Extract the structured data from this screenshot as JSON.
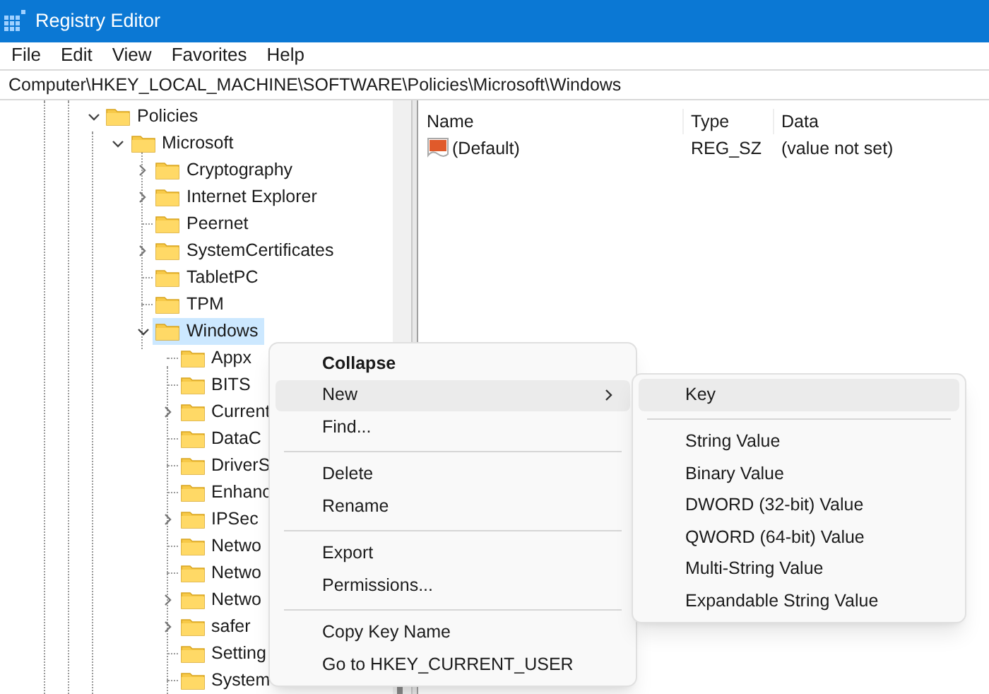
{
  "window": {
    "title": "Registry Editor"
  },
  "menu_bar": [
    "File",
    "Edit",
    "View",
    "Favorites",
    "Help"
  ],
  "address": "Computer\\HKEY_LOCAL_MACHINE\\SOFTWARE\\Policies\\Microsoft\\Windows",
  "tree": [
    {
      "label": "Policies",
      "kind": "branch",
      "expanded": true,
      "selected": false,
      "children": [
        {
          "label": "Microsoft",
          "kind": "branch",
          "expanded": true,
          "selected": false,
          "children": [
            {
              "label": "Cryptography",
              "kind": "branch",
              "expanded": false,
              "selected": false
            },
            {
              "label": "Internet Explorer",
              "kind": "branch",
              "expanded": false,
              "selected": false
            },
            {
              "label": "Peernet",
              "kind": "leaf",
              "selected": false
            },
            {
              "label": "SystemCertificates",
              "kind": "branch",
              "expanded": false,
              "selected": false
            },
            {
              "label": "TabletPC",
              "kind": "leaf",
              "selected": false
            },
            {
              "label": "TPM",
              "kind": "leaf",
              "selected": false
            },
            {
              "label": "Windows",
              "kind": "branch",
              "expanded": true,
              "selected": true,
              "children": [
                {
                  "label": "Appx",
                  "kind": "leaf",
                  "selected": false
                },
                {
                  "label": "BITS",
                  "kind": "leaf",
                  "selected": false
                },
                {
                  "label": "Current",
                  "kind": "branch",
                  "expanded": false,
                  "selected": false
                },
                {
                  "label": "DataC",
                  "kind": "leaf",
                  "selected": false
                },
                {
                  "label": "DriverS",
                  "kind": "leaf",
                  "selected": false
                },
                {
                  "label": "Enhanc",
                  "kind": "leaf",
                  "selected": false
                },
                {
                  "label": "IPSec",
                  "kind": "branch",
                  "expanded": false,
                  "selected": false
                },
                {
                  "label": "Netwo",
                  "kind": "leaf",
                  "selected": false
                },
                {
                  "label": "Netwo",
                  "kind": "leaf",
                  "selected": false
                },
                {
                  "label": "Netwo",
                  "kind": "branch",
                  "expanded": false,
                  "selected": false
                },
                {
                  "label": "safer",
                  "kind": "branch",
                  "expanded": false,
                  "selected": false
                },
                {
                  "label": "Setting",
                  "kind": "leaf",
                  "selected": false
                },
                {
                  "label": "System",
                  "kind": "leaf",
                  "selected": false
                }
              ]
            }
          ]
        }
      ]
    }
  ],
  "values_table": {
    "columns": [
      "Name",
      "Type",
      "Data"
    ],
    "rows": [
      {
        "name": "(Default)",
        "type": "REG_SZ",
        "data": "(value not set)"
      }
    ]
  },
  "context_menu": [
    {
      "kind": "item",
      "label": "Collapse",
      "default": true,
      "selected": false,
      "submenu": false
    },
    {
      "kind": "item",
      "label": "New",
      "default": false,
      "selected": true,
      "submenu": true
    },
    {
      "kind": "item",
      "label": "Find...",
      "default": false,
      "selected": false,
      "submenu": false
    },
    {
      "kind": "separator"
    },
    {
      "kind": "item",
      "label": "Delete",
      "default": false,
      "selected": false,
      "submenu": false
    },
    {
      "kind": "item",
      "label": "Rename",
      "default": false,
      "selected": false,
      "submenu": false
    },
    {
      "kind": "separator"
    },
    {
      "kind": "item",
      "label": "Export",
      "default": false,
      "selected": false,
      "submenu": false
    },
    {
      "kind": "item",
      "label": "Permissions...",
      "default": false,
      "selected": false,
      "submenu": false
    },
    {
      "kind": "separator"
    },
    {
      "kind": "item",
      "label": "Copy Key Name",
      "default": false,
      "selected": false,
      "submenu": false
    },
    {
      "kind": "item",
      "label": "Go to HKEY_CURRENT_USER",
      "default": false,
      "selected": false,
      "submenu": false
    }
  ],
  "submenu": [
    {
      "kind": "item",
      "label": "Key",
      "selected": true
    },
    {
      "kind": "separator"
    },
    {
      "kind": "item",
      "label": "String Value",
      "selected": false
    },
    {
      "kind": "item",
      "label": "Binary Value",
      "selected": false
    },
    {
      "kind": "item",
      "label": "DWORD (32-bit) Value",
      "selected": false
    },
    {
      "kind": "item",
      "label": "QWORD (64-bit) Value",
      "selected": false
    },
    {
      "kind": "item",
      "label": "Multi-String Value",
      "selected": false
    },
    {
      "kind": "item",
      "label": "Expandable String Value",
      "selected": false
    }
  ]
}
